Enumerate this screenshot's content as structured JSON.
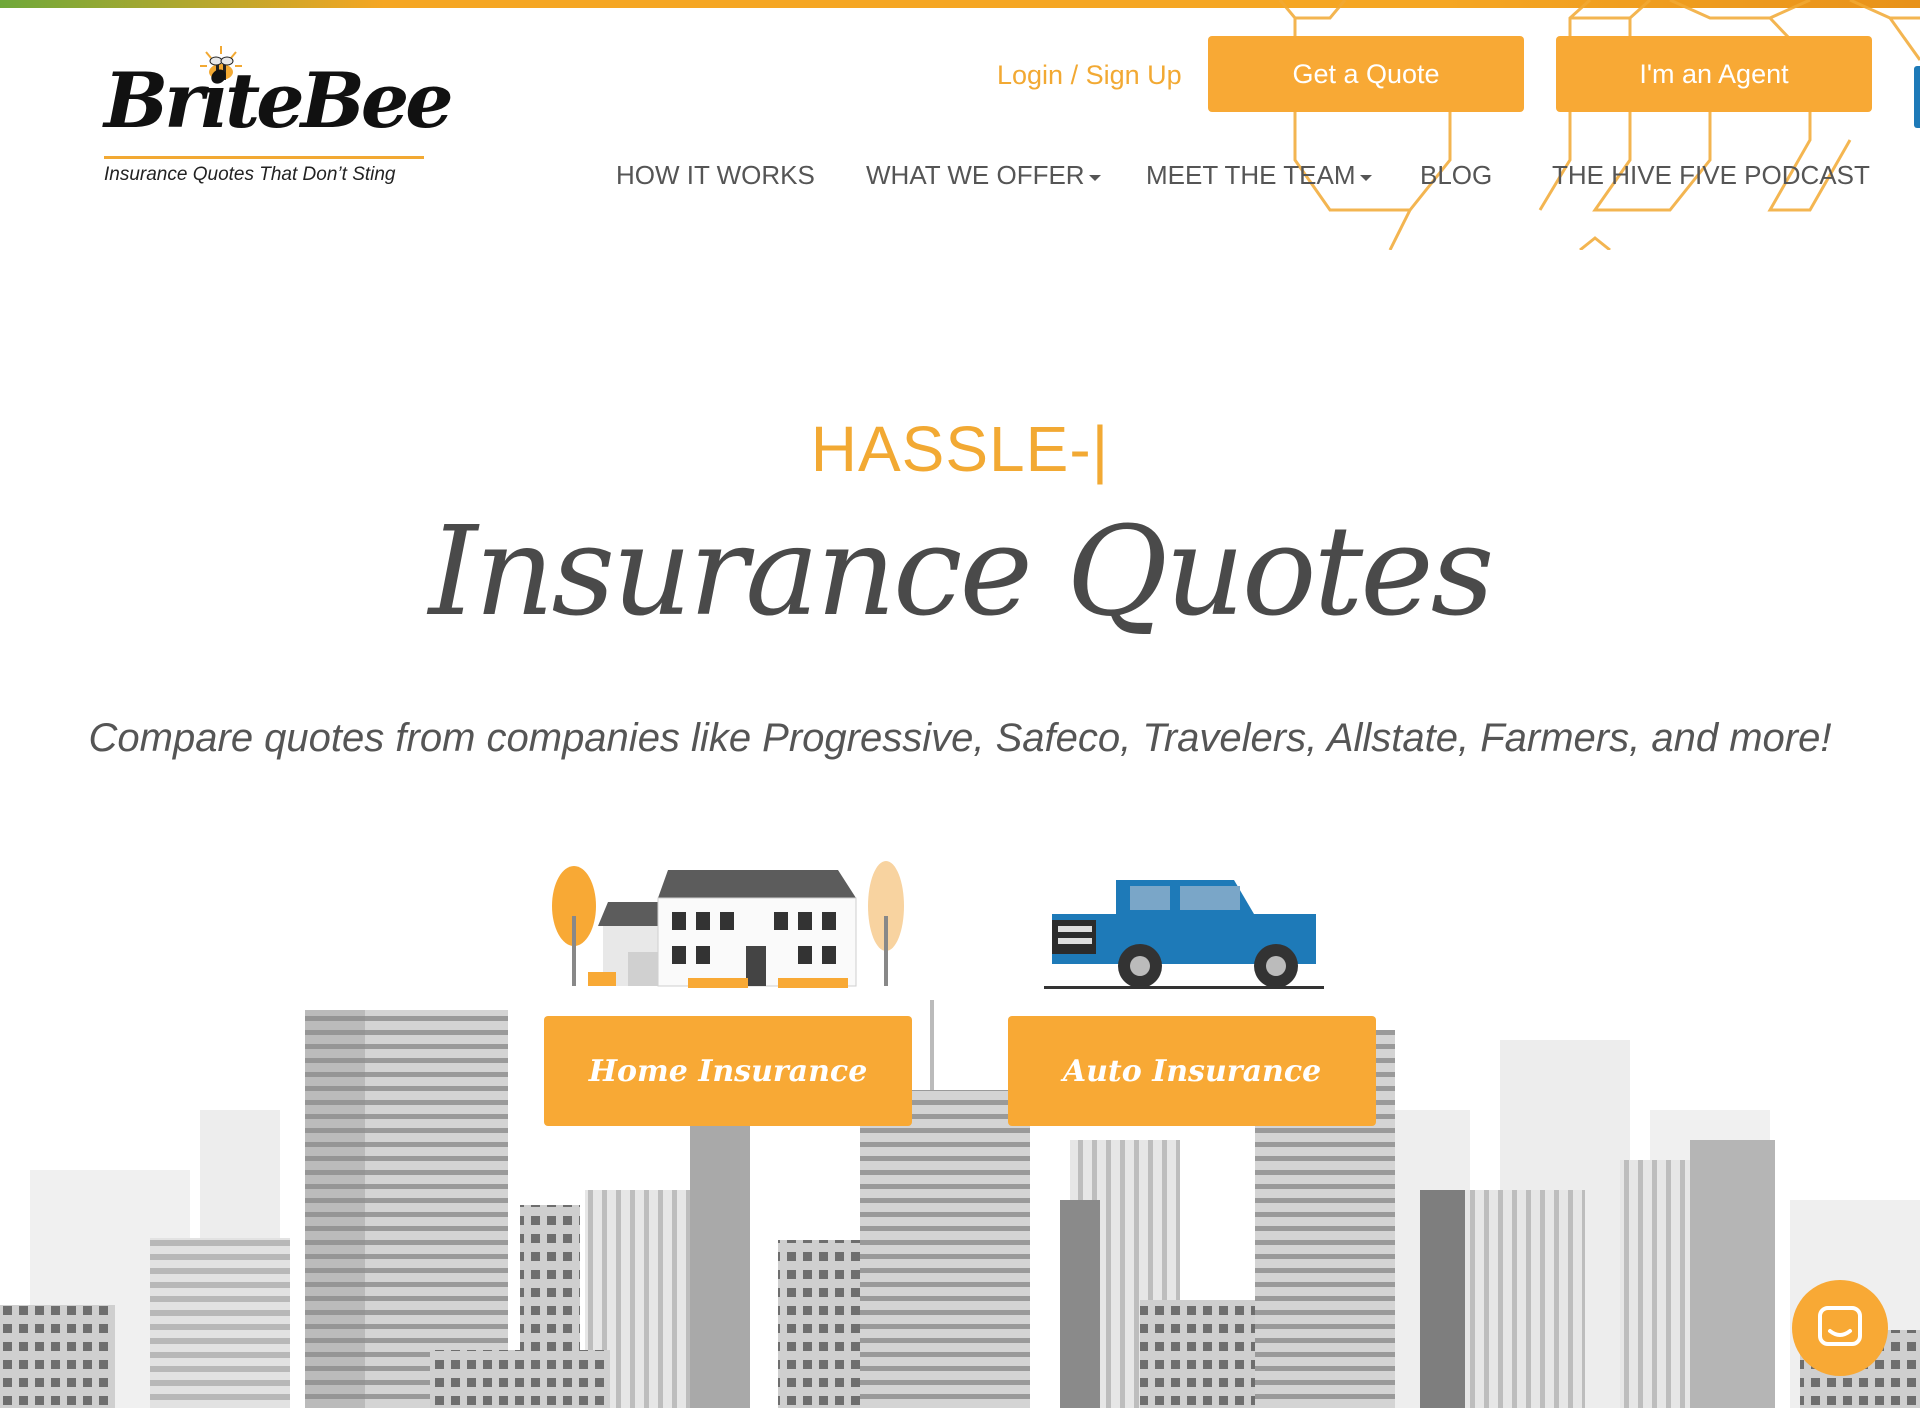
{
  "brand": {
    "name": "BriteBee",
    "tagline": "Insurance Quotes That Don’t Sting",
    "accent_color": "#f8a935",
    "text_color": "#4a4a4a"
  },
  "header": {
    "login_label": "Login / Sign Up",
    "quote_button": "Get a Quote",
    "agent_button": "I'm an Agent"
  },
  "nav": {
    "items": [
      {
        "label": "HOW IT WORKS",
        "has_dropdown": false
      },
      {
        "label": "WHAT WE OFFER",
        "has_dropdown": true
      },
      {
        "label": "MEET THE TEAM",
        "has_dropdown": true
      },
      {
        "label": "BLOG",
        "has_dropdown": false
      },
      {
        "label": "THE HIVE FIVE PODCAST",
        "has_dropdown": false
      }
    ]
  },
  "hero": {
    "eyebrow": "HASSLE-|",
    "title": "Insurance Quotes",
    "subtitle": "Compare quotes from companies like Progressive, Safeco, Travelers, Allstate, Farmers, and more!"
  },
  "cards": {
    "home_label": "Home Insurance",
    "auto_label": "Auto Insurance",
    "home_icon": "house-illustration",
    "auto_icon": "pickup-truck-illustration"
  },
  "widgets": {
    "chat_icon": "chat-bubble-icon"
  }
}
